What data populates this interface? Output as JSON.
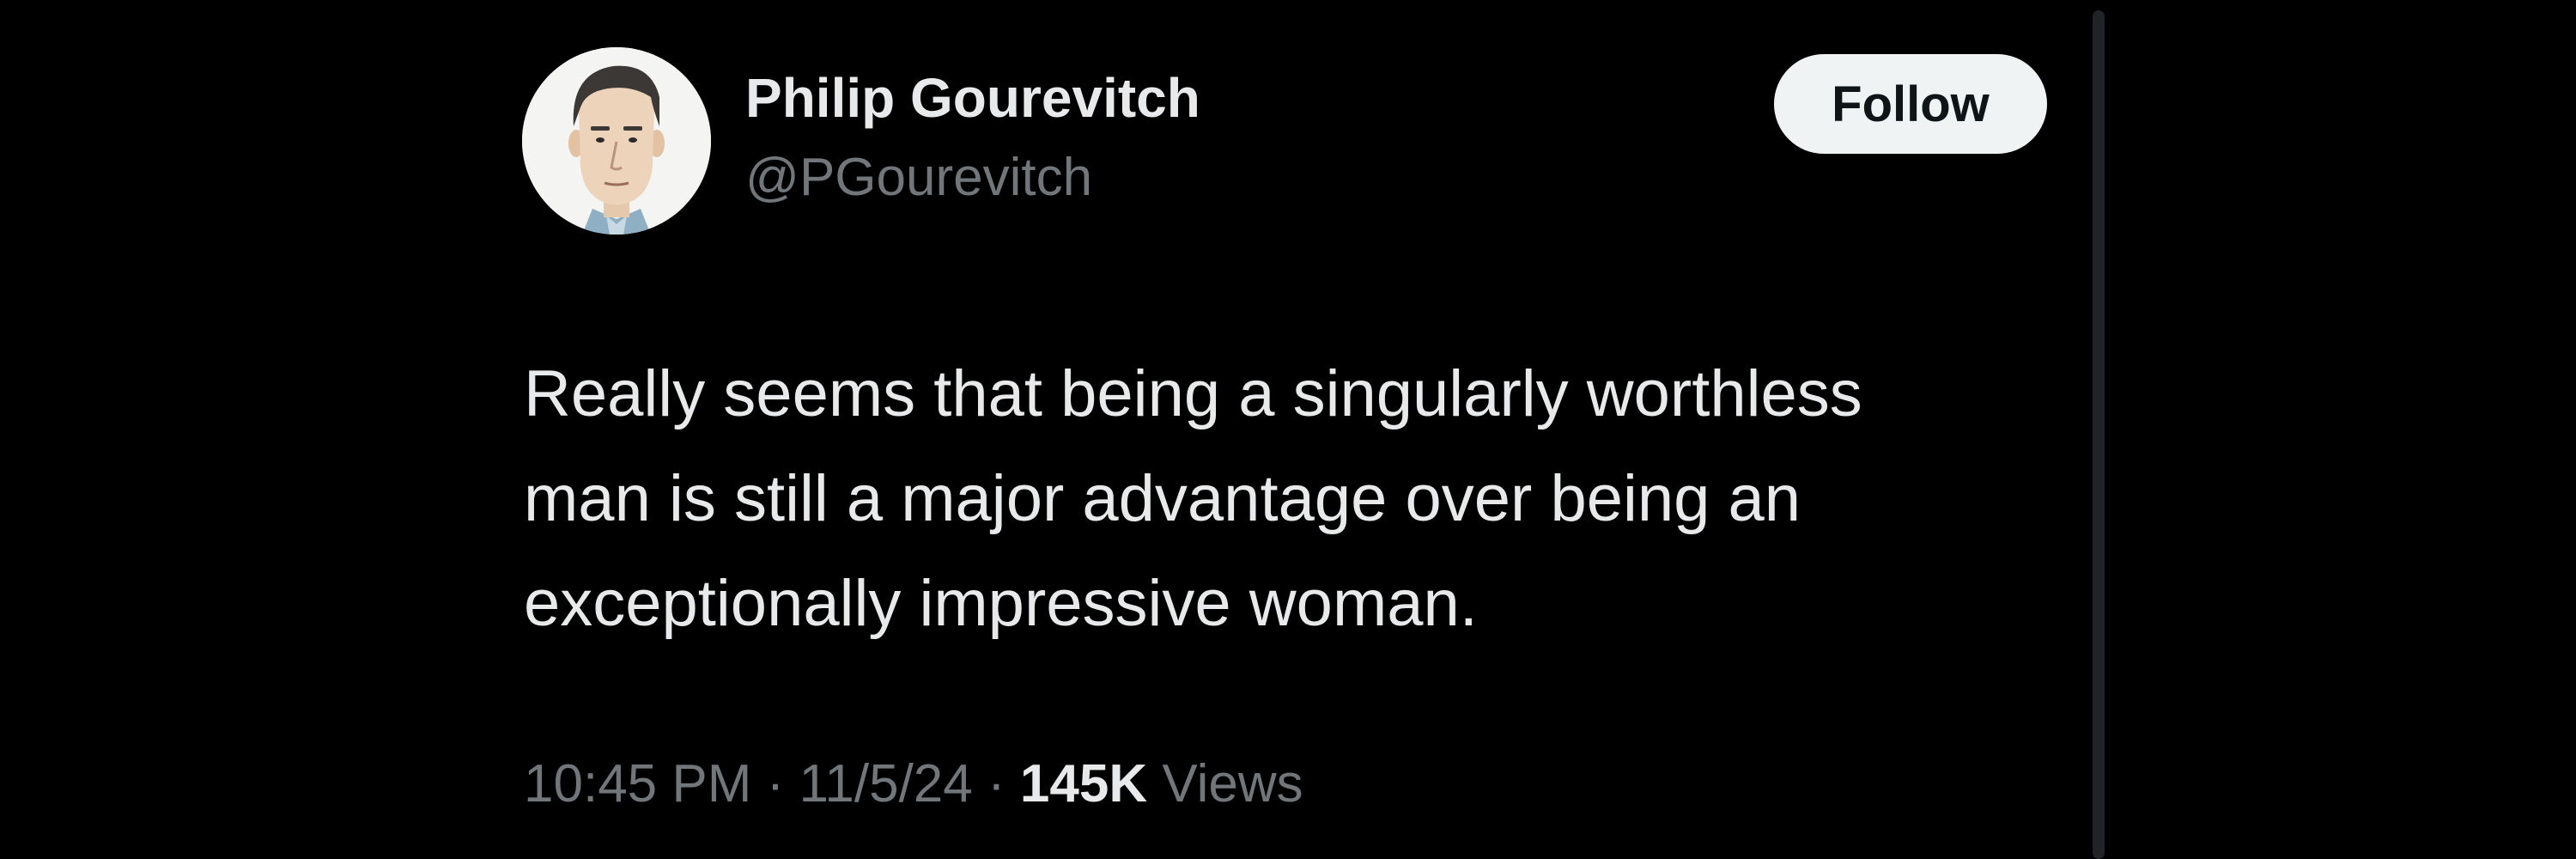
{
  "author": {
    "display_name": "Philip Gourevitch",
    "handle": "@PGourevitch"
  },
  "follow_label": "Follow",
  "tweet": {
    "lines": [
      "Really seems that being a singularly worthless",
      "man is still a major advantage over being an",
      "exceptionally impressive woman."
    ]
  },
  "meta": {
    "time": "10:45 PM",
    "separator": "·",
    "date": "11/5/24",
    "views_count": "145K",
    "views_label": "Views"
  },
  "colors": {
    "background": "#000000",
    "primary_text": "#e7e9ea",
    "secondary_text": "#71767b",
    "follow_button_bg": "#eff3f4",
    "follow_button_text": "#0f1419"
  }
}
